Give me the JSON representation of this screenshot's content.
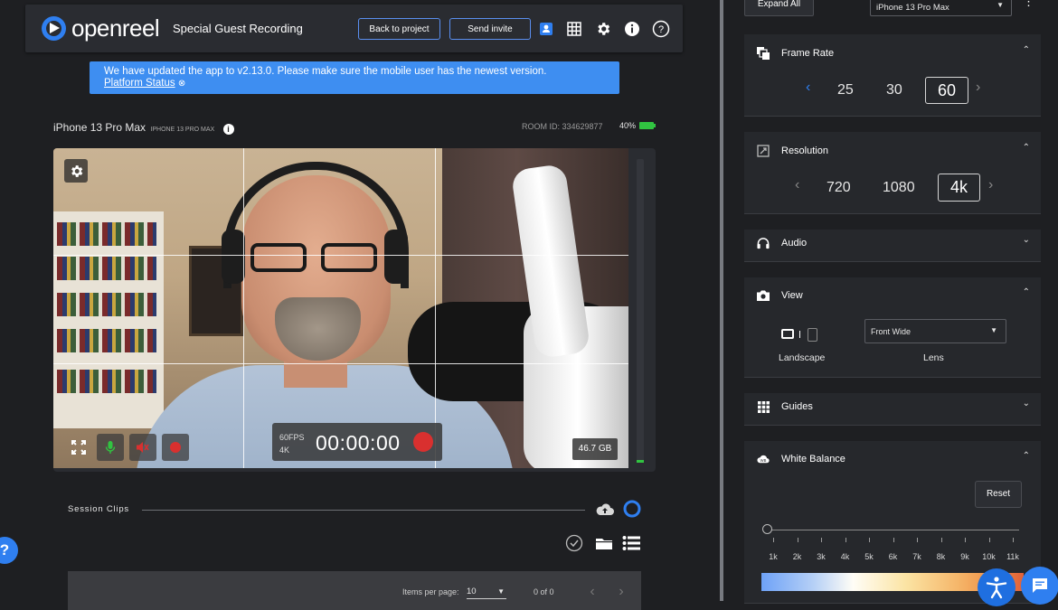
{
  "header": {
    "logo_text": "openreel",
    "title": "Special Guest Recording",
    "back_label": "Back to project",
    "invite_label": "Send invite"
  },
  "banner": {
    "message": "We have updated the app to v2.13.0. Please make sure the mobile user has the newest version.",
    "link": "Platform Status"
  },
  "device": {
    "name": "iPhone 13 Pro Max",
    "model": "IPHONE 13 PRO MAX",
    "room_id": "ROOM ID: 334629877",
    "battery": "40%"
  },
  "recorder": {
    "fps": "60FPS",
    "resolution": "4K",
    "timer": "00:00:00",
    "storage": "46.7 GB"
  },
  "clips": {
    "label": "Session Clips",
    "items_per_page_label": "Items per page:",
    "items_per_page": "10",
    "count": "0 of 0"
  },
  "panel": {
    "expand_all": "Expand All",
    "device_select": "iPhone 13 Pro Max",
    "frame_rate": {
      "title": "Frame Rate",
      "options": [
        "25",
        "30",
        "60"
      ],
      "selected": "60"
    },
    "resolution": {
      "title": "Resolution",
      "options": [
        "720",
        "1080",
        "4k"
      ],
      "selected": "4k"
    },
    "audio": {
      "title": "Audio"
    },
    "view": {
      "title": "View",
      "orientation_label": "Landscape",
      "lens_value": "Front Wide",
      "lens_label": "Lens"
    },
    "guides": {
      "title": "Guides"
    },
    "white_balance": {
      "title": "White Balance",
      "reset": "Reset",
      "ticks": [
        "1k",
        "2k",
        "3k",
        "4k",
        "5k",
        "6k",
        "7k",
        "8k",
        "9k",
        "10k",
        "11k"
      ]
    }
  },
  "colors": {
    "accent": "#2f7ff0",
    "banner": "#3e8ef1",
    "record": "#d9302f",
    "battery": "#31c441"
  }
}
